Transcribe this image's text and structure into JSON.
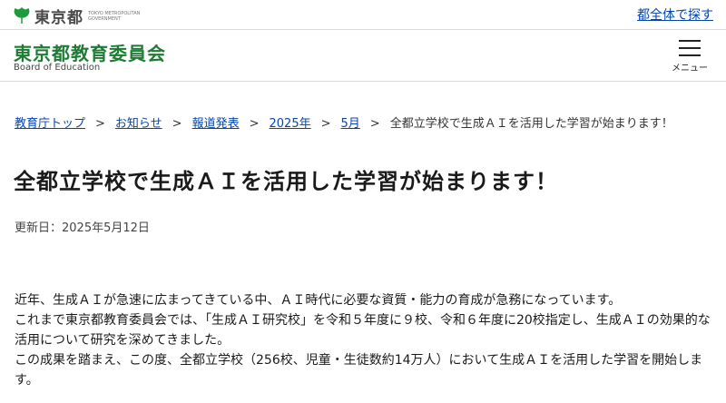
{
  "header": {
    "logo_text": "東京都",
    "logo_subtext": "TOKYO METROPOLITAN GOVERNMENT",
    "site_search_link": "都全体で探す",
    "board_title": "東京都教育委員会",
    "board_subtitle": "Board of Education",
    "menu_label": "メニュー"
  },
  "breadcrumb": {
    "items": [
      "教育庁トップ",
      "お知らせ",
      "報道発表",
      "2025年",
      "5月"
    ],
    "current": "全都立学校で生成ＡＩを活用した学習が始まります！"
  },
  "article": {
    "title": "全都立学校で生成ＡＩを活用した学習が始まります！",
    "updated": "更新日：2025年5月12日",
    "paragraphs": [
      "近年、生成ＡＩが急速に広まってきている中、ＡＩ時代に必要な資質・能力の育成が急務になっています。",
      "これまで東京都教育委員会では、「生成ＡＩ研究校」を令和５年度に９校、令和６年度に20校指定し、生成ＡＩの効果的な活用について研究を深めてきました。",
      "この成果を踏まえ、この度、全都立学校（256校、児童・生徒数約14万人）において生成ＡＩを活用した学習を開始します。"
    ]
  },
  "colors": {
    "brand_green": "#1e7b34",
    "link": "#0645ad"
  }
}
